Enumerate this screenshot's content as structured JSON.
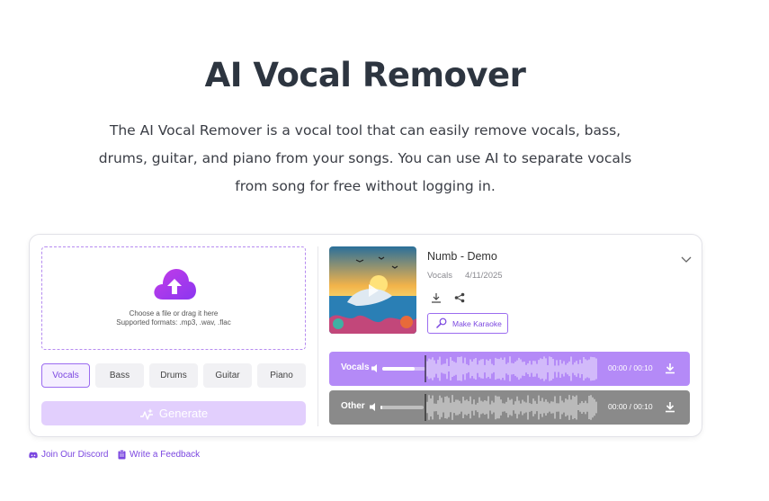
{
  "header": {
    "title": "AI Vocal Remover",
    "description": "The AI Vocal Remover is a vocal tool that can easily remove vocals, bass, drums, guitar, and piano from your songs. You can use AI to separate vocals from song for free without logging in."
  },
  "upload": {
    "line1": "Choose a file or drag it here",
    "line2": "Supported formats: .mp3, .wav, .flac",
    "icon": "cloud-upload-icon"
  },
  "stems": {
    "items": [
      "Vocals",
      "Bass",
      "Drums",
      "Guitar",
      "Piano"
    ],
    "selected": "Vocals"
  },
  "generate": {
    "label": "Generate"
  },
  "result": {
    "title": "Numb - Demo",
    "type": "Vocals",
    "date": "4/11/2025",
    "karaoke_label": "Make Karaoke"
  },
  "tracks": [
    {
      "label": "Vocals",
      "time": "00:00 / 00:10",
      "volume": 0.75
    },
    {
      "label": "Other",
      "time": "00:00 / 00:10",
      "volume": 0.05
    }
  ],
  "footer": {
    "discord": "Join Our Discord",
    "feedback": "Write a Feedback"
  },
  "colors": {
    "accent": "#7b47e0",
    "vocals_track": "#b48af7",
    "other_track": "#8a8a8a",
    "generate_disabled": "#e2cffd"
  }
}
